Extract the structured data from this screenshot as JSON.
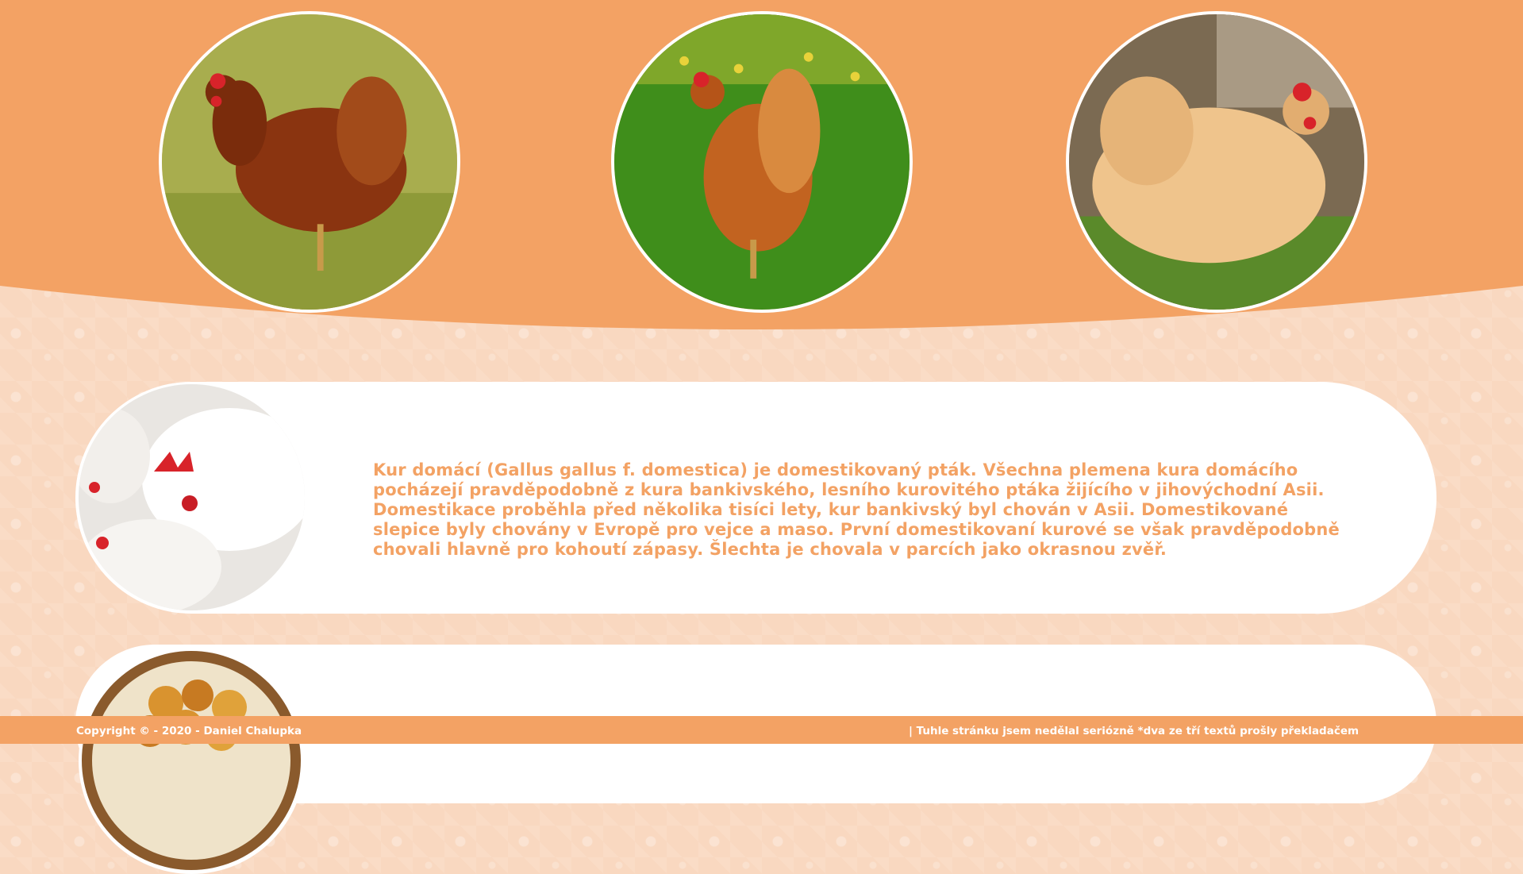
{
  "colors": {
    "accent": "#f3a264",
    "background": "#f9d8c0",
    "card": "#ffffff"
  },
  "header": {
    "photos": [
      {
        "icon": "hen-red-on-grass-photo"
      },
      {
        "icon": "hen-orange-on-green-grass-photo"
      },
      {
        "icon": "hen-buff-sitting-photo"
      }
    ]
  },
  "main": {
    "cards": [
      {
        "icon": "white-chickens-photo",
        "text": "Kur domácí (Gallus gallus f. domestica) je domestikovaný pták. Všechna plemena kura domácího pocházejí pravděpodobně z kura bankivského, lesního kurovitého ptáka žijícího v jihovýchodní Asii. Domestikace proběhla před několika tisíci lety, kur bankivský byl chován v Asii. Domestikované slepice byly chovány v Evropě pro vejce a maso. První domestikovaní kurové se však pravděpodobně chovali hlavně pro kohoutí zápasy. Šlechta je chovala v parcích jako okrasnou zvěř."
      },
      {
        "icon": "fried-chicken-plate-photo"
      }
    ]
  },
  "footer": {
    "copyright": "Copyright © - 2020 - Daniel Chalupka",
    "note": "| Tuhle stránku jsem nedělal seriózně   *dva ze tří textů prošly překladačem"
  }
}
